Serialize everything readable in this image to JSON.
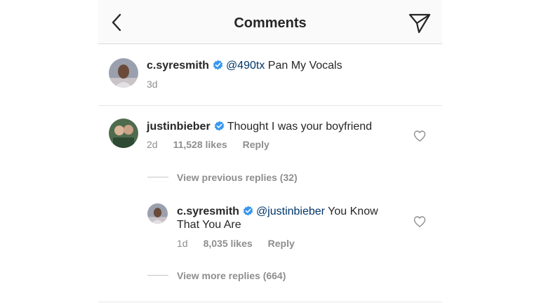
{
  "header": {
    "title": "Comments",
    "back_icon": "chevron-left-icon",
    "send_icon": "paper-plane-icon"
  },
  "caption": {
    "username": "c.syresmith",
    "mention": "@490tx",
    "text": "Pan My Vocals",
    "time": "3d"
  },
  "comment": {
    "username": "justinbieber",
    "text": "Thought I was your boyfriend",
    "time": "2d",
    "likes": "11,528 likes",
    "reply": "Reply",
    "view_previous": "View previous replies (32)"
  },
  "reply": {
    "username": "c.syresmith",
    "mention": "@justinbieber",
    "text": "You Know That You Are",
    "time": "1d",
    "likes": "8,035 likes",
    "reply": "Reply",
    "view_more": "View more replies (664)"
  },
  "colors": {
    "verified": "#3897f0",
    "mention": "#003569",
    "meta": "#8e8e8e",
    "header_bg": "#fafafa"
  }
}
